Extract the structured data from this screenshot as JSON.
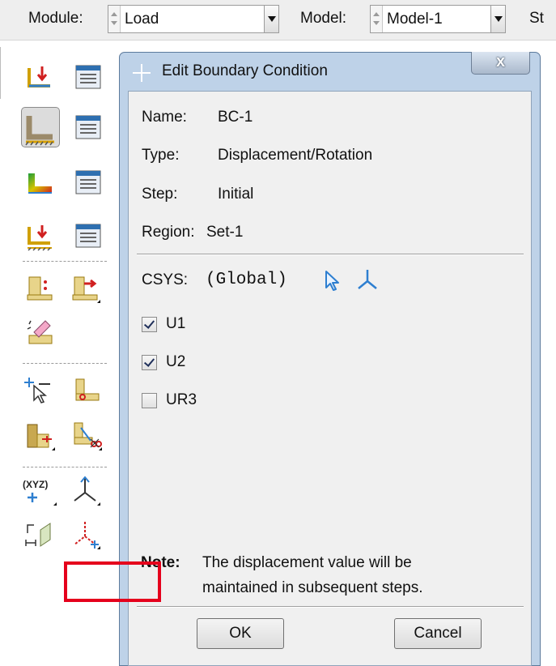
{
  "toolbar": {
    "module_label": "Module:",
    "module_value": "Load",
    "model_label": "Model:",
    "model_value": "Model-1",
    "step_label_partial": "St"
  },
  "toolbox": {
    "tools": [
      {
        "name": "create-load-icon"
      },
      {
        "name": "load-manager-icon"
      },
      {
        "name": "create-boundary-condition-icon",
        "pressed": true
      },
      {
        "name": "boundary-condition-manager-icon"
      },
      {
        "name": "create-predefined-field-icon"
      },
      {
        "name": "predefined-field-manager-icon"
      },
      {
        "name": "create-load-case-icon"
      },
      {
        "name": "load-case-manager-icon"
      },
      {
        "name": "create-special-icon"
      },
      {
        "name": "special-manager-icon"
      },
      {
        "name": "eraser-icon"
      },
      {
        "name": "select-point-icon"
      },
      {
        "name": "partition-icon"
      },
      {
        "name": "extrude-icon"
      },
      {
        "name": "cut-icon"
      },
      {
        "name": "datum-point-icon"
      },
      {
        "name": "datum-axis-icon"
      },
      {
        "name": "datum-plane-icon"
      },
      {
        "name": "datum-csys-icon"
      }
    ]
  },
  "dialog": {
    "title": "Edit Boundary Condition",
    "close_label": "x",
    "name_label": "Name:",
    "name_value": "BC-1",
    "type_label": "Type:",
    "type_value": "Displacement/Rotation",
    "step_label": "Step:",
    "step_value": "Initial",
    "region_label": "Region:",
    "region_value": "Set-1",
    "csys_label": "CSYS:",
    "csys_value": "(Global)",
    "dofs": [
      {
        "label": "U1",
        "checked": true
      },
      {
        "label": "U2",
        "checked": true
      },
      {
        "label": "UR3",
        "checked": false
      }
    ],
    "note_label": "Note:",
    "note_line1": "The displacement value will be",
    "note_line2": "maintained in subsequent steps.",
    "ok_label": "OK",
    "cancel_label": "Cancel"
  },
  "colors": {
    "dialog_frame": "#bed2e8",
    "highlight": "#e5001c",
    "csys_icon": "#2e7fd0"
  }
}
